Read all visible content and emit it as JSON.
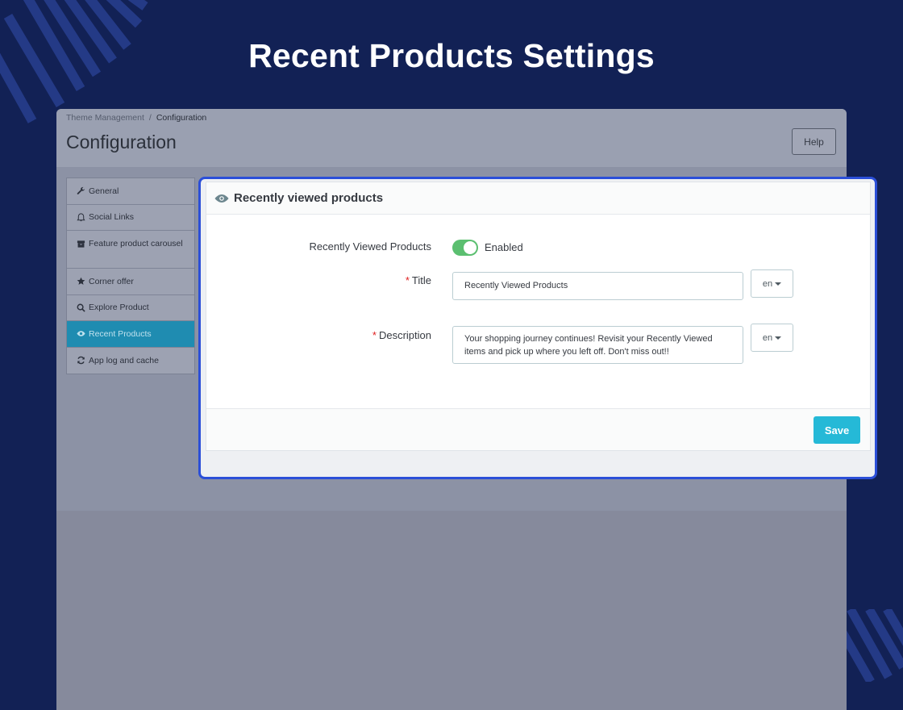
{
  "hero": {
    "title": "Recent Products Settings"
  },
  "breadcrumb": {
    "parent": "Theme Management",
    "separator": "/",
    "current": "Configuration"
  },
  "page": {
    "heading": "Configuration",
    "help_label": "Help"
  },
  "sidebar": {
    "items": [
      {
        "label": "General",
        "icon": "wrench-icon"
      },
      {
        "label": "Social Links",
        "icon": "bell-icon"
      },
      {
        "label": "Feature product carousel",
        "icon": "archive-icon"
      },
      {
        "label": "Corner offer",
        "icon": "star-icon"
      },
      {
        "label": "Explore Product",
        "icon": "search-icon"
      },
      {
        "label": "Recent Products",
        "icon": "eye-icon",
        "active": true
      },
      {
        "label": "App log and cache",
        "icon": "refresh-icon"
      }
    ]
  },
  "panel": {
    "title": "Recently viewed products",
    "icon": "eye-icon",
    "toggle": {
      "label": "Recently Viewed Products",
      "state_text": "Enabled",
      "on": true
    },
    "title_field": {
      "label": "Title",
      "required_mark": "*",
      "value": "Recently Viewed Products",
      "lang": "en"
    },
    "description_field": {
      "label": "Description",
      "required_mark": "*",
      "value": "Your shopping journey continues! Revisit your Recently Viewed items and pick up where you left off. Don't miss out!!",
      "lang": "en"
    },
    "save_label": "Save"
  },
  "colors": {
    "background": "#122155",
    "accent": "#25b9d7",
    "focus": "#2b4fd8",
    "toggle_on": "#5bbf70",
    "required": "#e02020"
  }
}
